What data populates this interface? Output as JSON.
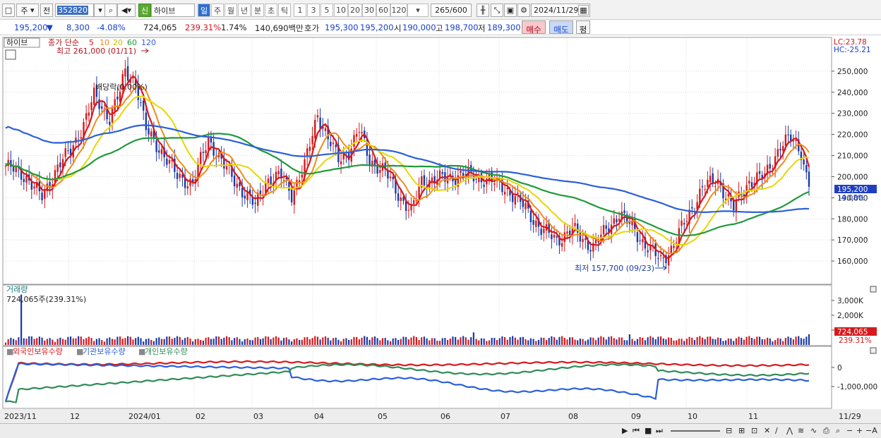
{
  "toolbar": {
    "mode": "주",
    "prev_label": "전",
    "code": "352820",
    "new_badge": "신",
    "stock_name": "하이브",
    "periods": [
      "일",
      "주",
      "월",
      "년",
      "분",
      "초",
      "틱"
    ],
    "selected_period": "일",
    "intervals": [
      "1",
      "3",
      "5",
      "10",
      "20",
      "30",
      "60",
      "120"
    ],
    "count": "265",
    "count_total": "/600",
    "date": "2024/11/29"
  },
  "status": {
    "price": "195,200",
    "change": "8,300",
    "change_pct": "-4.08%",
    "volume": "724,065",
    "volume_ratio": "239.31%",
    "turnover_rate": "1.74%",
    "amount": "140,690백만",
    "quote_label": "호가",
    "ask": "195,300",
    "bid": "195,200",
    "open_label": "시",
    "open": "190,000",
    "high_label": "고",
    "high": "198,700",
    "low_label": "저",
    "low": "189,300",
    "buy_button": "매수",
    "sell_button": "매도",
    "eval_button": "평"
  },
  "price_pane": {
    "tag": "하이브",
    "legend_prefix": "종가 단순",
    "ma_legend": [
      {
        "label": "5",
        "color": "#d7191c"
      },
      {
        "label": "10",
        "color": "#f08c1a"
      },
      {
        "label": "20",
        "color": "#e6d800"
      },
      {
        "label": "60",
        "color": "#1f9a3b"
      },
      {
        "label": "120",
        "color": "#2b5fd9"
      }
    ],
    "high_annotation": "최고 261,000 (01/11)",
    "low_annotation": "최저 157,700 (09/23)",
    "dividend_annotation": "배당락(0.00%)",
    "lc": "LC:23.78",
    "hc": "HC:-25.21",
    "current_price_tag": "195,200",
    "current_change_tag": "-4.08%",
    "y_ticks": [
      "250,000",
      "240,000",
      "230,000",
      "220,000",
      "210,000",
      "200,000",
      "190,000",
      "180,000",
      "170,000",
      "160,000"
    ]
  },
  "volume_pane": {
    "title": "거래량",
    "value_text": "724,065주(239.31%)",
    "y_ticks": [
      "3,000K",
      "2,000K",
      "1,000K"
    ],
    "current_tag": "724,065",
    "current_pct_tag": "239.31%"
  },
  "holding_pane": {
    "legend": [
      {
        "label": "외국인보유수량",
        "color": "#d7191c"
      },
      {
        "label": "기관보유수량",
        "color": "#2b5fd9"
      },
      {
        "label": "개인보유수량",
        "color": "#2e8b57"
      }
    ],
    "y_ticks": [
      "0",
      "-1,000,000"
    ]
  },
  "x_axis": {
    "labels": [
      "2023/11",
      "12",
      "2024/01",
      "02",
      "03",
      "04",
      "05",
      "06",
      "07",
      "08",
      "09",
      "10",
      "11",
      "11/29"
    ]
  },
  "chart_data": {
    "type": "candlestick",
    "x_labels": [
      "2023/11",
      "12",
      "2024/01",
      "02",
      "03",
      "04",
      "05",
      "06",
      "07",
      "08",
      "09",
      "10",
      "11"
    ],
    "ylim": [
      150000,
      265000
    ],
    "price_keypoints": [
      [
        0,
        205000
      ],
      [
        8,
        200000
      ],
      [
        14,
        190000
      ],
      [
        20,
        205000
      ],
      [
        25,
        212000
      ],
      [
        30,
        225000
      ],
      [
        34,
        238000
      ],
      [
        40,
        228000
      ],
      [
        44,
        240000
      ],
      [
        46,
        250000
      ],
      [
        50,
        245000
      ],
      [
        54,
        222000
      ],
      [
        60,
        212000
      ],
      [
        66,
        200000
      ],
      [
        72,
        197000
      ],
      [
        78,
        218000
      ],
      [
        84,
        205000
      ],
      [
        90,
        195000
      ],
      [
        96,
        186000
      ],
      [
        100,
        198000
      ],
      [
        106,
        200000
      ],
      [
        110,
        192000
      ],
      [
        115,
        205000
      ],
      [
        120,
        230000
      ],
      [
        124,
        218000
      ],
      [
        128,
        208000
      ],
      [
        132,
        212000
      ],
      [
        136,
        222000
      ],
      [
        140,
        208000
      ],
      [
        146,
        202000
      ],
      [
        152,
        190000
      ],
      [
        156,
        183000
      ],
      [
        160,
        198000
      ],
      [
        168,
        199000
      ],
      [
        176,
        201000
      ],
      [
        184,
        199000
      ],
      [
        192,
        195000
      ],
      [
        200,
        185000
      ],
      [
        206,
        175000
      ],
      [
        212,
        170000
      ],
      [
        218,
        175000
      ],
      [
        222,
        170000
      ],
      [
        226,
        167000
      ],
      [
        232,
        176000
      ],
      [
        236,
        183000
      ],
      [
        240,
        177000
      ],
      [
        246,
        168000
      ],
      [
        252,
        160000
      ],
      [
        256,
        166000
      ],
      [
        262,
        180000
      ],
      [
        268,
        195000
      ],
      [
        274,
        198000
      ],
      [
        280,
        185000
      ],
      [
        286,
        198000
      ],
      [
        292,
        200000
      ],
      [
        298,
        215000
      ],
      [
        302,
        218000
      ],
      [
        306,
        212000
      ],
      [
        309,
        195200
      ]
    ],
    "ma_periods": [
      5,
      10,
      20,
      60,
      120
    ],
    "last_close": 195200,
    "period_high": 261000,
    "period_low": 157700
  }
}
